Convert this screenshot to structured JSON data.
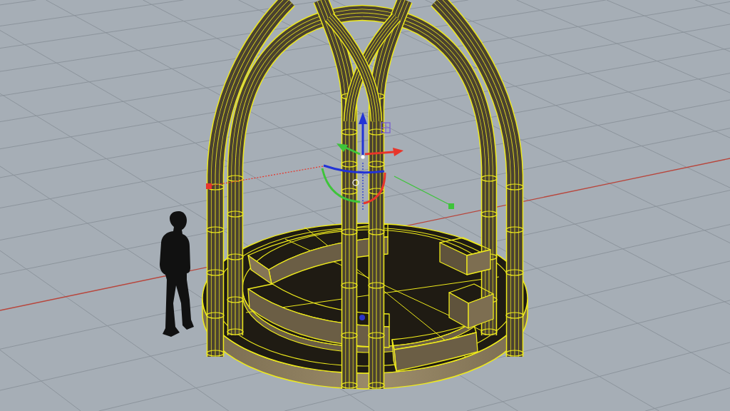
{
  "viewport": {
    "gumball": {
      "axes": [
        {
          "kind": "x",
          "color": "#e8352a"
        },
        {
          "kind": "y",
          "color": "#3ec43a"
        },
        {
          "kind": "z",
          "color": "#2233d6"
        }
      ]
    }
  }
}
